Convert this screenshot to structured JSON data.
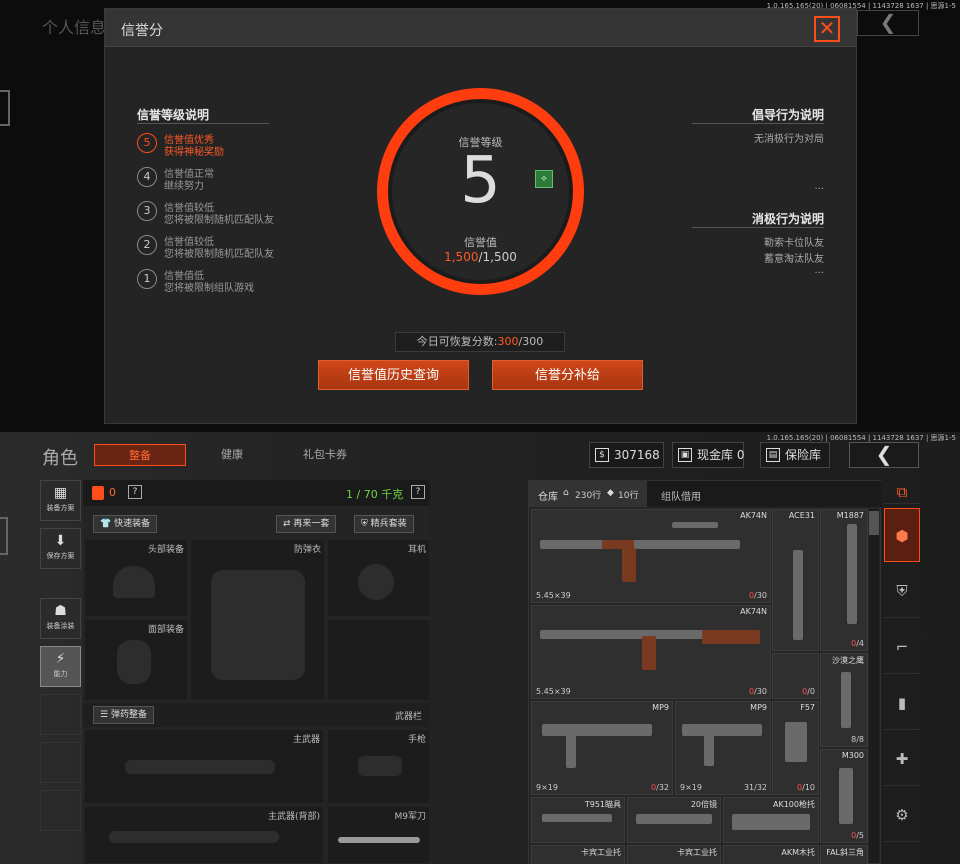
{
  "top": {
    "version": "1.0.165.165(20) | 06081554 | 1143728 1637 | 思源1-5",
    "bg_title": "个人信息",
    "modal": {
      "title": "信誉分",
      "close_icon": "close-icon",
      "left_section_title": "信誉等级说明",
      "levels": [
        {
          "num": "5",
          "l1": "信誉值优秀",
          "l2": "获得神秘奖励",
          "active": true
        },
        {
          "num": "4",
          "l1": "信誉值正常",
          "l2": "继续努力",
          "active": false
        },
        {
          "num": "3",
          "l1": "信誉值较低",
          "l2": "您将被限制随机匹配队友",
          "active": false
        },
        {
          "num": "2",
          "l1": "信誉值较低",
          "l2": "您将被限制随机匹配队友",
          "active": false
        },
        {
          "num": "1",
          "l1": "信誉值低",
          "l2": "您将被限制组队游戏",
          "active": false
        }
      ],
      "ring": {
        "title": "信誉等级",
        "level": "5",
        "sub": "信誉值",
        "current": "1,500",
        "max": "/1,500"
      },
      "right_section1_title": "倡导行为说明",
      "right_section1_text": "无消极行为对局",
      "right_section2_title": "消极行为说明",
      "right_section2_items": [
        "勒索卡位队友",
        "蓄意淘汰队友"
      ],
      "ellipsis": "...",
      "restore_label": "今日可恢复分数:",
      "restore_current": "300",
      "restore_max": "/300",
      "btn_history": "信誉值历史查询",
      "btn_supplement": "信誉分补给"
    }
  },
  "bottom": {
    "version": "1.0.165.165(20) | 06081554 | 1143728 1637 | 思源1-5",
    "role_title": "角色",
    "tabs": [
      "整备",
      "健康",
      "礼包卡券"
    ],
    "currency": "307168",
    "cash_storage": "现金库 0",
    "safe_box": "保险库",
    "left_sidebar": [
      "装备方案",
      "保存方案",
      "装备涂装",
      "能力"
    ],
    "equip_header": {
      "backpack_count": "0",
      "weight": "1 / 70 千克",
      "help": "?"
    },
    "equip_buttons": {
      "quick": "快速装备",
      "again": "再来一套",
      "elite": "精兵套装",
      "ammo": "弹药整备"
    },
    "slots": {
      "helmet": "头部装备",
      "armor": "防弹衣",
      "earphone": "耳机",
      "face": "面部装备",
      "weapon_bar": "武器栏",
      "primary": "主武器",
      "pistol": "手枪",
      "primary_back": "主武器(背部)",
      "melee": "M9军刀"
    },
    "inventory_header": {
      "tab_storage": "仓库",
      "rows": "230行",
      "rows2": "10行",
      "tab_team": "组队借用"
    },
    "items": [
      {
        "name": "AK74N",
        "caliber": "5.45×39",
        "ammo_cur": "0",
        "ammo_max": "/30"
      },
      {
        "name": "ACE31",
        "caliber": "",
        "ammo_cur": "",
        "ammo_max": ""
      },
      {
        "name": "M1887",
        "caliber": "",
        "ammo_cur": "0",
        "ammo_max": "/4"
      },
      {
        "name": "AK74N",
        "caliber": "5.45×39",
        "ammo_cur": "0",
        "ammo_max": "/30"
      },
      {
        "name": "",
        "caliber": "",
        "ammo_cur": "0",
        "ammo_max": "/0"
      },
      {
        "name": "沙漠之鹰",
        "caliber": "",
        "ammo_cur": "8",
        "ammo_max": "/8"
      },
      {
        "name": "MP9",
        "caliber": "9×19",
        "ammo_cur": "0",
        "ammo_max": "/32"
      },
      {
        "name": "MP9",
        "caliber": "9×19",
        "ammo_cur": "31",
        "ammo_max": "/32"
      },
      {
        "name": "F57",
        "caliber": "",
        "ammo_cur": "0",
        "ammo_max": "/10"
      },
      {
        "name": "M300",
        "caliber": "",
        "ammo_cur": "0",
        "ammo_max": "/5"
      },
      {
        "name": "T951瞄具",
        "caliber": "",
        "ammo_cur": "",
        "ammo_max": ""
      },
      {
        "name": "20倍镜",
        "caliber": "",
        "ammo_cur": "",
        "ammo_max": ""
      },
      {
        "name": "AK100枪托",
        "caliber": "",
        "ammo_cur": "",
        "ammo_max": ""
      },
      {
        "name": "卡宾工业托",
        "caliber": "",
        "ammo_cur": "",
        "ammo_max": ""
      },
      {
        "name": "卡宾工业托",
        "caliber": "",
        "ammo_cur": "",
        "ammo_max": ""
      },
      {
        "name": "AKM木托",
        "caliber": "",
        "ammo_cur": "",
        "ammo_max": ""
      },
      {
        "name": "FAL斜三角",
        "caliber": "",
        "ammo_cur": "",
        "ammo_max": ""
      }
    ]
  }
}
